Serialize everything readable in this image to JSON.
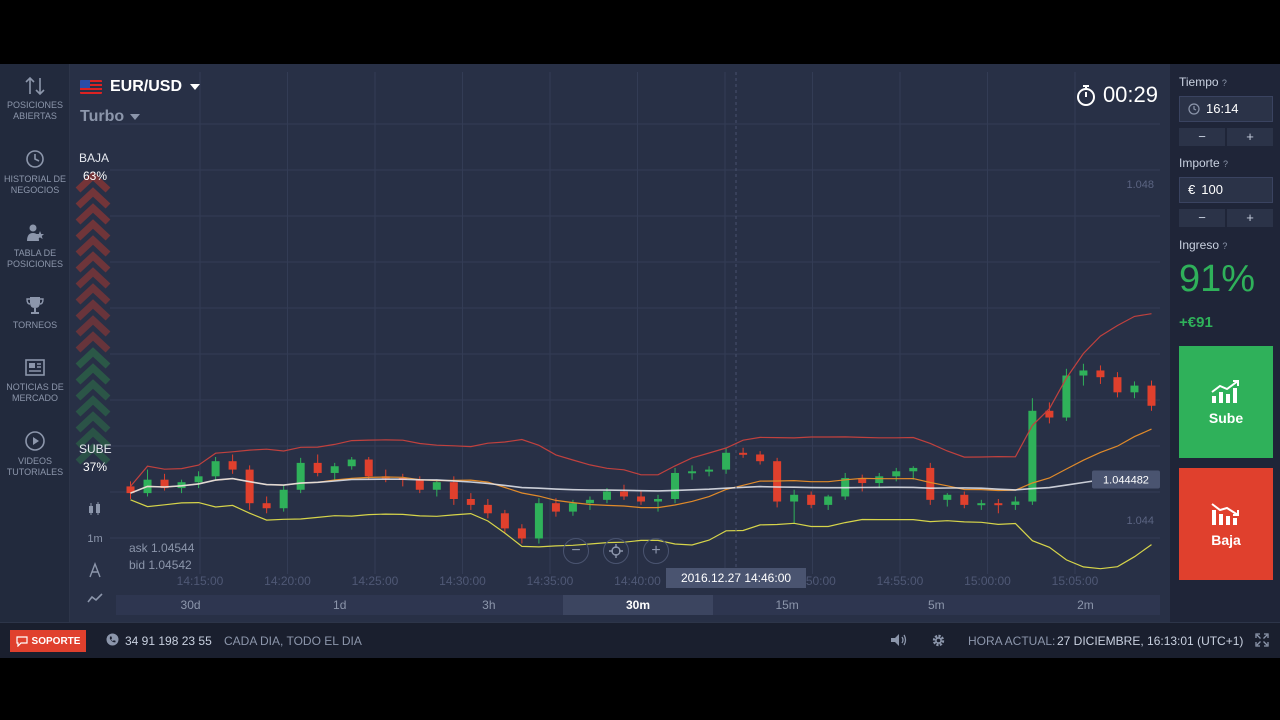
{
  "sidebar": {
    "items": [
      {
        "label": "POSICIONES ABIERTAS",
        "icon": "arrows-updown-icon"
      },
      {
        "label": "HISTORIAL DE NEGOCIOS",
        "icon": "history-icon"
      },
      {
        "label": "TABLA DE POSICIONES",
        "icon": "leaderboard-icon"
      },
      {
        "label": "TORNEOS",
        "icon": "trophy-icon"
      },
      {
        "label": "NOTICIAS DE MERCADO",
        "icon": "news-icon"
      },
      {
        "label": "VIDEOS TUTORIALES",
        "icon": "play-icon"
      }
    ]
  },
  "header": {
    "pair": "EUR/USD",
    "mode": "Turbo",
    "timer": "00:29"
  },
  "sentiment": {
    "down_label": "BAJA",
    "down_pct": "63%",
    "up_label": "SUBE",
    "up_pct": "37%"
  },
  "tools": {
    "interval": "1m"
  },
  "quote": {
    "ask": "ask 1.04544",
    "bid": "bid 1.04542"
  },
  "tooltip": "2016.12.27 14:46:00",
  "periods": [
    "30d",
    "1d",
    "3h",
    "30m",
    "15m",
    "5m",
    "2m"
  ],
  "right_panel": {
    "time_label": "Tiempo",
    "time_value": "16:14",
    "amount_label": "Importe",
    "amount_currency": "€",
    "amount_value": "100",
    "income_label": "Ingreso",
    "payout": "91%",
    "income": "+€91",
    "call_label": "Sube",
    "put_label": "Baja"
  },
  "footer": {
    "support": "SOPORTE",
    "phone": "34 91 198 23 55",
    "hours": "CADA DIA, TODO EL DIA",
    "clock_label": "HORA ACTUAL:",
    "clock_value": "27 DICIEMBRE, 16:13:01 (UTC+1)"
  },
  "colors": {
    "bull": "#2fb15a",
    "bear": "#e0402d",
    "upper_band": "#c0413e",
    "middle_band": "#e08a2a",
    "lower_band": "#d6d44a",
    "price_line": "#e6e9f0"
  },
  "chart_data": {
    "type": "candlestick",
    "symbol": "EUR/USD",
    "current_price": 1.044482,
    "y_ticks": [
      1.048,
      1.044
    ],
    "x_ticks": [
      "14:15:00",
      "14:20:00",
      "14:25:00",
      "14:30:00",
      "14:35:00",
      "14:40:00",
      "14:45:00",
      "14:50:00",
      "14:55:00",
      "15:00:00",
      "15:05:00"
    ],
    "grid": true,
    "indicators": [
      "bollinger_upper",
      "bollinger_middle",
      "bollinger_lower"
    ],
    "candles": [
      {
        "o": 1.0444,
        "h": 1.04446,
        "l": 1.04425,
        "c": 1.04432
      },
      {
        "o": 1.04432,
        "h": 1.0446,
        "l": 1.04428,
        "c": 1.04448
      },
      {
        "o": 1.04448,
        "h": 1.04455,
        "l": 1.04435,
        "c": 1.04438
      },
      {
        "o": 1.04438,
        "h": 1.04448,
        "l": 1.04432,
        "c": 1.04445
      },
      {
        "o": 1.04445,
        "h": 1.04458,
        "l": 1.04438,
        "c": 1.04452
      },
      {
        "o": 1.04452,
        "h": 1.04475,
        "l": 1.04448,
        "c": 1.0447
      },
      {
        "o": 1.0447,
        "h": 1.04478,
        "l": 1.04455,
        "c": 1.0446
      },
      {
        "o": 1.0446,
        "h": 1.04465,
        "l": 1.04412,
        "c": 1.0442
      },
      {
        "o": 1.0442,
        "h": 1.04428,
        "l": 1.04408,
        "c": 1.04414
      },
      {
        "o": 1.04414,
        "h": 1.04442,
        "l": 1.0441,
        "c": 1.04436
      },
      {
        "o": 1.04436,
        "h": 1.04474,
        "l": 1.04432,
        "c": 1.04468
      },
      {
        "o": 1.04468,
        "h": 1.04478,
        "l": 1.04452,
        "c": 1.04456
      },
      {
        "o": 1.04456,
        "h": 1.04468,
        "l": 1.04448,
        "c": 1.04464
      },
      {
        "o": 1.04464,
        "h": 1.04475,
        "l": 1.0446,
        "c": 1.04472
      },
      {
        "o": 1.04472,
        "h": 1.04475,
        "l": 1.04448,
        "c": 1.04452
      },
      {
        "o": 1.04452,
        "h": 1.0446,
        "l": 1.04445,
        "c": 1.0445
      },
      {
        "o": 1.0445,
        "h": 1.04455,
        "l": 1.0444,
        "c": 1.04448
      },
      {
        "o": 1.04448,
        "h": 1.04452,
        "l": 1.04432,
        "c": 1.04436
      },
      {
        "o": 1.04436,
        "h": 1.04448,
        "l": 1.04428,
        "c": 1.04445
      },
      {
        "o": 1.04445,
        "h": 1.04452,
        "l": 1.04418,
        "c": 1.04425
      },
      {
        "o": 1.04425,
        "h": 1.04432,
        "l": 1.04412,
        "c": 1.04418
      },
      {
        "o": 1.04418,
        "h": 1.04425,
        "l": 1.04402,
        "c": 1.04408
      },
      {
        "o": 1.04408,
        "h": 1.04412,
        "l": 1.04385,
        "c": 1.0439
      },
      {
        "o": 1.0439,
        "h": 1.04395,
        "l": 1.04372,
        "c": 1.04378
      },
      {
        "o": 1.04378,
        "h": 1.04426,
        "l": 1.04372,
        "c": 1.0442
      },
      {
        "o": 1.0442,
        "h": 1.04426,
        "l": 1.04404,
        "c": 1.0441
      },
      {
        "o": 1.0441,
        "h": 1.04424,
        "l": 1.04405,
        "c": 1.0442
      },
      {
        "o": 1.0442,
        "h": 1.04428,
        "l": 1.04412,
        "c": 1.04424
      },
      {
        "o": 1.04424,
        "h": 1.04438,
        "l": 1.0442,
        "c": 1.04434
      },
      {
        "o": 1.04434,
        "h": 1.04442,
        "l": 1.04424,
        "c": 1.04428
      },
      {
        "o": 1.04428,
        "h": 1.04434,
        "l": 1.04418,
        "c": 1.04422
      },
      {
        "o": 1.04422,
        "h": 1.0443,
        "l": 1.0441,
        "c": 1.04425
      },
      {
        "o": 1.04425,
        "h": 1.04462,
        "l": 1.0442,
        "c": 1.04456
      },
      {
        "o": 1.04456,
        "h": 1.04465,
        "l": 1.04448,
        "c": 1.04458
      },
      {
        "o": 1.04458,
        "h": 1.04464,
        "l": 1.04452,
        "c": 1.0446
      },
      {
        "o": 1.0446,
        "h": 1.04485,
        "l": 1.04455,
        "c": 1.0448
      },
      {
        "o": 1.0448,
        "h": 1.04486,
        "l": 1.04474,
        "c": 1.04478
      },
      {
        "o": 1.04478,
        "h": 1.04482,
        "l": 1.04466,
        "c": 1.0447
      },
      {
        "o": 1.0447,
        "h": 1.04474,
        "l": 1.04415,
        "c": 1.04422
      },
      {
        "o": 1.04422,
        "h": 1.04436,
        "l": 1.04396,
        "c": 1.0443
      },
      {
        "o": 1.0443,
        "h": 1.04434,
        "l": 1.04414,
        "c": 1.04418
      },
      {
        "o": 1.04418,
        "h": 1.0443,
        "l": 1.04412,
        "c": 1.04428
      },
      {
        "o": 1.04428,
        "h": 1.04456,
        "l": 1.04424,
        "c": 1.0445
      },
      {
        "o": 1.0445,
        "h": 1.04454,
        "l": 1.04434,
        "c": 1.04444
      },
      {
        "o": 1.04444,
        "h": 1.04456,
        "l": 1.04438,
        "c": 1.04452
      },
      {
        "o": 1.04452,
        "h": 1.04462,
        "l": 1.04446,
        "c": 1.04458
      },
      {
        "o": 1.04458,
        "h": 1.04464,
        "l": 1.04448,
        "c": 1.04462
      },
      {
        "o": 1.04462,
        "h": 1.04468,
        "l": 1.04418,
        "c": 1.04424
      },
      {
        "o": 1.04424,
        "h": 1.04432,
        "l": 1.04416,
        "c": 1.0443
      },
      {
        "o": 1.0443,
        "h": 1.04434,
        "l": 1.04414,
        "c": 1.04418
      },
      {
        "o": 1.04418,
        "h": 1.04424,
        "l": 1.04412,
        "c": 1.0442
      },
      {
        "o": 1.0442,
        "h": 1.04425,
        "l": 1.04408,
        "c": 1.04418
      },
      {
        "o": 1.04418,
        "h": 1.04428,
        "l": 1.04412,
        "c": 1.04422
      },
      {
        "o": 1.04422,
        "h": 1.04545,
        "l": 1.04418,
        "c": 1.0453
      },
      {
        "o": 1.0453,
        "h": 1.0454,
        "l": 1.04515,
        "c": 1.04522
      },
      {
        "o": 1.04522,
        "h": 1.0458,
        "l": 1.04518,
        "c": 1.04572
      },
      {
        "o": 1.04572,
        "h": 1.04586,
        "l": 1.0456,
        "c": 1.04578
      },
      {
        "o": 1.04578,
        "h": 1.04584,
        "l": 1.04562,
        "c": 1.0457
      },
      {
        "o": 1.0457,
        "h": 1.04576,
        "l": 1.04546,
        "c": 1.04552
      },
      {
        "o": 1.04552,
        "h": 1.04565,
        "l": 1.04545,
        "c": 1.0456
      },
      {
        "o": 1.0456,
        "h": 1.04566,
        "l": 1.0453,
        "c": 1.04536
      }
    ]
  }
}
